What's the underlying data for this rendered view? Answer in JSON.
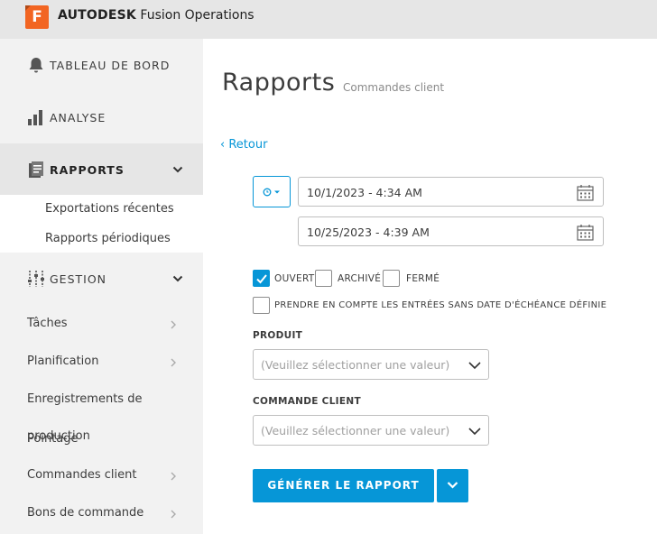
{
  "app": {
    "logo_letter": "F",
    "brand_bold": "AUTODESK",
    "brand_rest": "Fusion Operations",
    "accent": "#0696d7",
    "logo_color": "#f26522"
  },
  "sidebar": {
    "main_items": [
      {
        "label": "TABLEAU DE BORD",
        "icon": "bell-icon"
      },
      {
        "label": "ANALYSE",
        "icon": "bar-chart-icon"
      },
      {
        "label": "RAPPORTS",
        "icon": "report-icon",
        "active": true
      },
      {
        "label": "GESTION",
        "icon": "sliders-icon"
      }
    ],
    "rapports_sub": [
      "Exportations récentes",
      "Rapports périodiques"
    ],
    "gestion_sub": [
      "Tâches",
      "Planification",
      "Enregistrements de",
      "production",
      "Pointage",
      "Commandes client",
      "Bons de commande"
    ]
  },
  "main": {
    "title": "Rapports",
    "subtitle": "Commandes client",
    "back": "‹ Retour",
    "date_from": "10/1/2023 - 4:34 AM",
    "date_to": "10/25/2023 - 4:39 AM",
    "status_filters": [
      {
        "label": "OUVERT",
        "checked": true
      },
      {
        "label": "ARCHIVÉ",
        "checked": false
      },
      {
        "label": "FERMÉ",
        "checked": false
      }
    ],
    "include_no_due": "PRENDRE EN COMPTE LES ENTRÉES SANS DATE D'ÉCHÉANCE DÉFINIE",
    "product_label": "PRODUIT",
    "product_placeholder": "(Veuillez sélectionner une valeur)",
    "order_label": "COMMANDE CLIENT",
    "order_placeholder": "(Veuillez sélectionner une valeur)",
    "generate": "GÉNÉRER LE RAPPORT"
  }
}
